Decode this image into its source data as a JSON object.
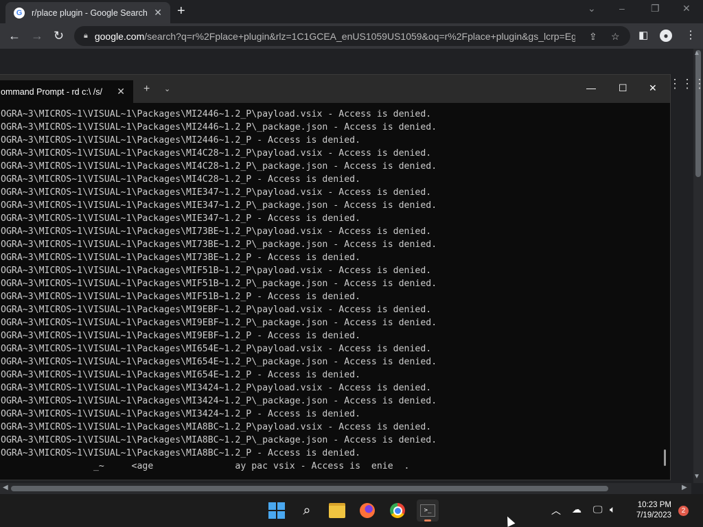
{
  "browser": {
    "tab_title": "r/place plugin - Google Search",
    "tab_favicon_letter": "G",
    "url_host": "google.com",
    "url_path": "/search?q=r%2Fplace+plugin&rlz=1C1GCEA_enUS1059US1059&oq=r%2Fplace+plugin&gs_lcrp=Eg..."
  },
  "terminal": {
    "tab_title": "ommand Prompt - rd  c:\\ /s/",
    "lines": [
      "OGRA~3\\MICROS~1\\VISUAL~1\\Packages\\MI2446~1.2_P\\payload.vsix - Access is denied.",
      "OGRA~3\\MICROS~1\\VISUAL~1\\Packages\\MI2446~1.2_P\\_package.json - Access is denied.",
      "OGRA~3\\MICROS~1\\VISUAL~1\\Packages\\MI2446~1.2_P - Access is denied.",
      "OGRA~3\\MICROS~1\\VISUAL~1\\Packages\\MI4C28~1.2_P\\payload.vsix - Access is denied.",
      "OGRA~3\\MICROS~1\\VISUAL~1\\Packages\\MI4C28~1.2_P\\_package.json - Access is denied.",
      "OGRA~3\\MICROS~1\\VISUAL~1\\Packages\\MI4C28~1.2_P - Access is denied.",
      "OGRA~3\\MICROS~1\\VISUAL~1\\Packages\\MIE347~1.2_P\\payload.vsix - Access is denied.",
      "OGRA~3\\MICROS~1\\VISUAL~1\\Packages\\MIE347~1.2_P\\_package.json - Access is denied.",
      "OGRA~3\\MICROS~1\\VISUAL~1\\Packages\\MIE347~1.2_P - Access is denied.",
      "OGRA~3\\MICROS~1\\VISUAL~1\\Packages\\MI73BE~1.2_P\\payload.vsix - Access is denied.",
      "OGRA~3\\MICROS~1\\VISUAL~1\\Packages\\MI73BE~1.2_P\\_package.json - Access is denied.",
      "OGRA~3\\MICROS~1\\VISUAL~1\\Packages\\MI73BE~1.2_P - Access is denied.",
      "OGRA~3\\MICROS~1\\VISUAL~1\\Packages\\MIF51B~1.2_P\\payload.vsix - Access is denied.",
      "OGRA~3\\MICROS~1\\VISUAL~1\\Packages\\MIF51B~1.2_P\\_package.json - Access is denied.",
      "OGRA~3\\MICROS~1\\VISUAL~1\\Packages\\MIF51B~1.2_P - Access is denied.",
      "OGRA~3\\MICROS~1\\VISUAL~1\\Packages\\MI9EBF~1.2_P\\payload.vsix - Access is denied.",
      "OGRA~3\\MICROS~1\\VISUAL~1\\Packages\\MI9EBF~1.2_P\\_package.json - Access is denied.",
      "OGRA~3\\MICROS~1\\VISUAL~1\\Packages\\MI9EBF~1.2_P - Access is denied.",
      "OGRA~3\\MICROS~1\\VISUAL~1\\Packages\\MI654E~1.2_P\\payload.vsix - Access is denied.",
      "OGRA~3\\MICROS~1\\VISUAL~1\\Packages\\MI654E~1.2_P\\_package.json - Access is denied.",
      "OGRA~3\\MICROS~1\\VISUAL~1\\Packages\\MI654E~1.2_P - Access is denied.",
      "OGRA~3\\MICROS~1\\VISUAL~1\\Packages\\MI3424~1.2_P\\payload.vsix - Access is denied.",
      "OGRA~3\\MICROS~1\\VISUAL~1\\Packages\\MI3424~1.2_P\\_package.json - Access is denied.",
      "OGRA~3\\MICROS~1\\VISUAL~1\\Packages\\MI3424~1.2_P - Access is denied.",
      "OGRA~3\\MICROS~1\\VISUAL~1\\Packages\\MIA8BC~1.2_P\\payload.vsix - Access is denied.",
      "OGRA~3\\MICROS~1\\VISUAL~1\\Packages\\MIA8BC~1.2_P\\_package.json - Access is denied.",
      "OGRA~3\\MICROS~1\\VISUAL~1\\Packages\\MIA8BC~1.2_P - Access is denied.",
      "                 _~     <age               ay pac vsix - Access is  enie  ."
    ]
  },
  "taskbar": {
    "time": "10:23 PM",
    "date": "7/19/2023",
    "notification_count": "2"
  },
  "colors": {
    "accent": "#4aa8f0",
    "terminal_bg": "#0c0c0c",
    "terminal_text": "#cccccc",
    "badge": "#e05a4a"
  }
}
